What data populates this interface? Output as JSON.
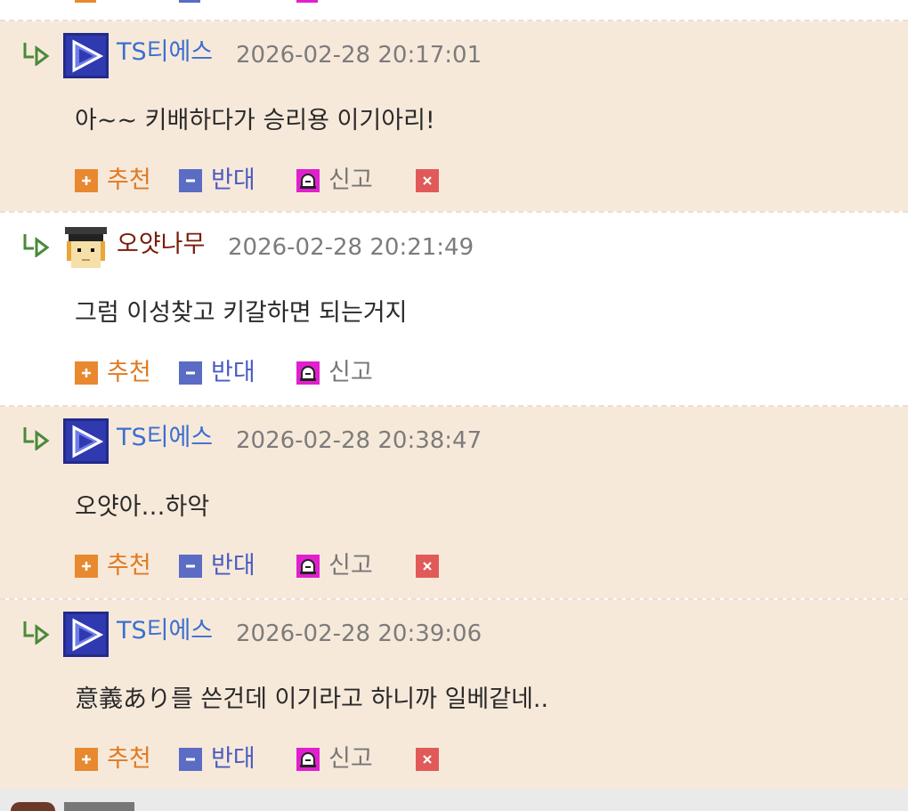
{
  "comments": [
    {
      "nick": "TS티에스",
      "time": "2026-02-28 20:17:01",
      "text": "아~~ 키배하다가 승리용 이기아리!",
      "up_label": "추천",
      "down_label": "반대",
      "report_label": "신고",
      "deletable": true,
      "avatar": "play-icon",
      "bg": "tan"
    },
    {
      "nick": "오얏나무",
      "time": "2026-02-28 20:21:49",
      "text": "그럼 이성찾고 키갈하면 되는거지",
      "up_label": "추천",
      "down_label": "반대",
      "report_label": "신고",
      "deletable": false,
      "avatar": "student-icon",
      "bg": "white"
    },
    {
      "nick": "TS티에스",
      "time": "2026-02-28 20:38:47",
      "text": "오얏아…하악",
      "up_label": "추천",
      "down_label": "반대",
      "report_label": "신고",
      "deletable": true,
      "avatar": "play-icon",
      "bg": "tan"
    },
    {
      "nick": "TS티에스",
      "time": "2026-02-28 20:39:06",
      "text": "意義あり를 쓴건데 이기라고 하니까 일베같네..",
      "up_label": "추천",
      "down_label": "반대",
      "report_label": "신고",
      "deletable": true,
      "avatar": "play-icon",
      "bg": "tan"
    }
  ],
  "colors": {
    "tan_bg": "#f7e9da",
    "nick_blue": "#3a6fd0",
    "nick_brown": "#7a1a0a",
    "recommend": "#e8892f",
    "oppose": "#5a6cc4",
    "report": "#e21fcf",
    "delete": "#e05a5a"
  }
}
